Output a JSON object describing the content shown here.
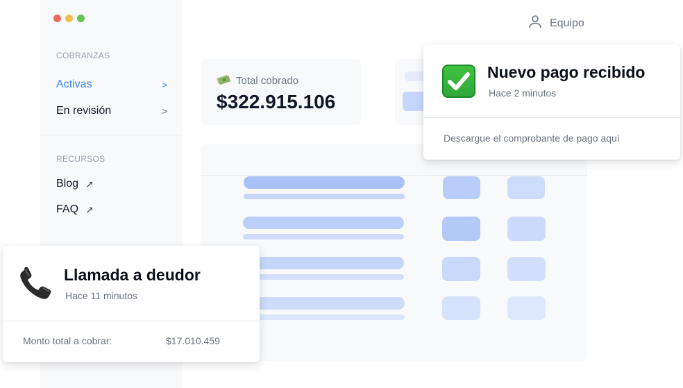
{
  "window": {
    "dots": [
      "#ed6a5e",
      "#f5bf4f",
      "#61c554"
    ]
  },
  "sidebar": {
    "sections": [
      {
        "label": "COBRANZAS",
        "items": [
          {
            "label": "Activas",
            "chevron": ">",
            "active": true
          },
          {
            "label": "En revisión",
            "chevron": ">",
            "active": false
          }
        ]
      },
      {
        "label": "RECURSOS",
        "items": [
          {
            "label": "Blog",
            "arrow": "↗"
          },
          {
            "label": "FAQ",
            "arrow": "↗"
          }
        ]
      }
    ]
  },
  "header": {
    "team_label": "Equipo",
    "team_icon": "user-icon"
  },
  "stat": {
    "icon": "money-icon",
    "label": "Total cobrado",
    "value": "$322.915.106"
  },
  "notification_payment": {
    "icon": "check-mark-icon",
    "title": "Nuevo pago recibido",
    "time": "Hace 2 minutos",
    "footer": "Descargue el comprobante de pago aquí"
  },
  "notification_call": {
    "icon": "telephone-icon",
    "title": "Llamada a deudor",
    "time": "Hace 11 minutos",
    "footer_label": "Monto total a cobrar:",
    "footer_value": "$17.010.459"
  },
  "colors": {
    "accent": "#3b82f6",
    "skeleton": "#c7d7fb",
    "skeleton_light": "#dbe6fd",
    "panel": "#f8f9fb"
  }
}
